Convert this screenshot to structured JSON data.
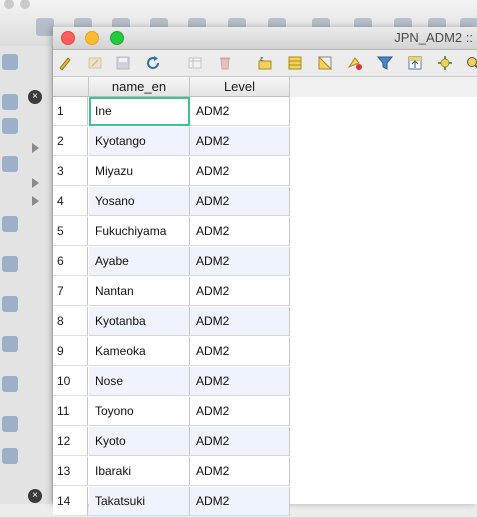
{
  "window": {
    "title": "JPN_ADM2 ::"
  },
  "table": {
    "columns": [
      "name_en",
      "Level"
    ],
    "rows": [
      {
        "n": "1",
        "name_en": "Ine",
        "level": "ADM2"
      },
      {
        "n": "2",
        "name_en": "Kyotango",
        "level": "ADM2"
      },
      {
        "n": "3",
        "name_en": "Miyazu",
        "level": "ADM2"
      },
      {
        "n": "4",
        "name_en": "Yosano",
        "level": "ADM2"
      },
      {
        "n": "5",
        "name_en": "Fukuchiyama",
        "level": "ADM2"
      },
      {
        "n": "6",
        "name_en": "Ayabe",
        "level": "ADM2"
      },
      {
        "n": "7",
        "name_en": "Nantan",
        "level": "ADM2"
      },
      {
        "n": "8",
        "name_en": "Kyotanba",
        "level": "ADM2"
      },
      {
        "n": "9",
        "name_en": "Kameoka",
        "level": "ADM2"
      },
      {
        "n": "10",
        "name_en": "Nose",
        "level": "ADM2"
      },
      {
        "n": "11",
        "name_en": "Toyono",
        "level": "ADM2"
      },
      {
        "n": "12",
        "name_en": "Kyoto",
        "level": "ADM2"
      },
      {
        "n": "13",
        "name_en": "Ibaraki",
        "level": "ADM2"
      },
      {
        "n": "14",
        "name_en": "Takatsuki",
        "level": "ADM2"
      }
    ]
  },
  "toolbar_icons": [
    "toggle-edit-icon",
    "multi-edit-icon",
    "save-edits-icon",
    "reload-icon",
    "add-feature-icon",
    "delete-feature-icon",
    "select-by-expression-icon",
    "select-all-icon",
    "invert-selection-icon",
    "deselect-all-icon",
    "filter-icon",
    "move-selection-top-icon",
    "pan-to-selection-icon",
    "zoom-to-selection-icon"
  ],
  "colors": {
    "selected_cell_border": "#3cc493",
    "alt_row": "#eef3fc"
  }
}
